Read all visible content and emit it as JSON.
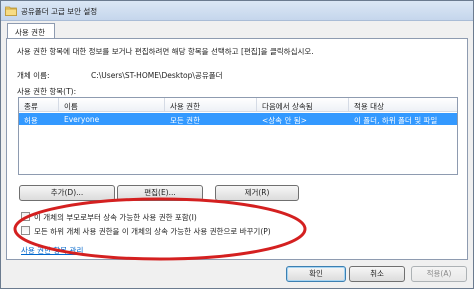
{
  "window": {
    "title": "공유폴더 고급 보안 설정"
  },
  "tabs": [
    {
      "label": "사용 권한"
    }
  ],
  "description": "사용 권한 항목에 대한 정보를 보거나 편집하려면 해당 항목을 선택하고 [편집]을 클릭하십시오.",
  "object": {
    "label": "개체 이름:",
    "value": "C:\\Users\\ST-HOME\\Desktop\\공유폴더"
  },
  "permissions": {
    "label": "사용 권한 항목(T):",
    "columns": [
      "종류",
      "이름",
      "사용 권한",
      "다음에서 상속됨",
      "적용 대상"
    ],
    "rows": [
      {
        "type": "허용",
        "name": "Everyone",
        "permission": "모든 권한",
        "inherited": "<상속 안 됨>",
        "applies_to": "이 폴더, 하위 폴더 및 파일"
      }
    ]
  },
  "buttons": {
    "add": "추가(D)...",
    "edit": "편집(E)...",
    "remove": "제거(R)",
    "ok": "확인",
    "cancel": "취소",
    "apply": "적용(A)"
  },
  "checkboxes": [
    {
      "label": "이 개체의 부모로부터 상속 가능한 사용 권한 포함(I)",
      "checked": false
    },
    {
      "label": "모든 하위 개체 사용 권한을 이 개체의 상속 가능한 사용 권한으로 바꾸기(P)",
      "checked": false
    }
  ],
  "link": "사용 권한 항목 관리",
  "colors": {
    "selection": "#3399ff",
    "annotation": "#d42020",
    "link": "#0066cc"
  }
}
